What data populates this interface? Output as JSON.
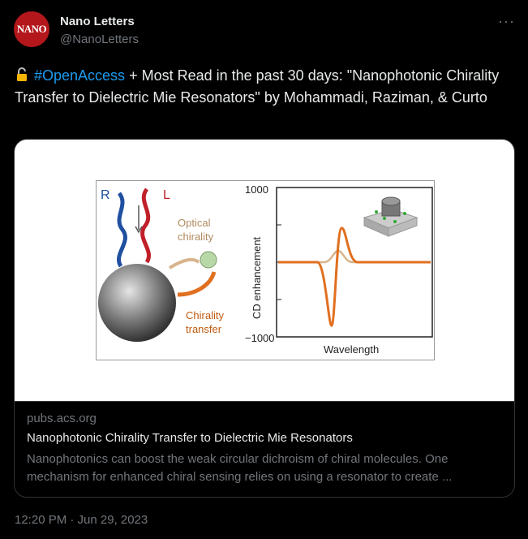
{
  "author": {
    "name": "Nano Letters",
    "handle": "@NanoLetters",
    "avatar_text": "NANO"
  },
  "tweet": {
    "lock_icon": "open-lock-icon",
    "hashtag": "#OpenAccess",
    "text": " + Most Read in the past 30 days: \"Nanophotonic Chirality Transfer to Dielectric Mie Resonators\" by Mohammadi, Raziman, & Curto"
  },
  "card": {
    "domain": "pubs.acs.org",
    "title": "Nanophotonic Chirality Transfer to Dielectric Mie Resonators",
    "description": "Nanophotonics can boost the weak circular dichroism of chiral molecules. One mechanism for enhanced chiral sensing relies on using a resonator to create ...",
    "figure": {
      "label_r": "R",
      "label_l": "L",
      "optical_chirality": [
        "Optical",
        "chirality"
      ],
      "chirality_transfer": [
        "Chirality",
        "transfer"
      ],
      "y_axis_label": "CD enhancement",
      "x_axis_label": "Wavelength",
      "y_max_tick": "1000",
      "y_min_tick": "−1000"
    }
  },
  "timestamp": "12:20 PM · Jun 29, 2023",
  "colors": {
    "accent": "#1d9bf0",
    "avatar_bg": "#b3171b",
    "orange_curve": "#e07020",
    "tan_curve": "#d8b48c"
  }
}
